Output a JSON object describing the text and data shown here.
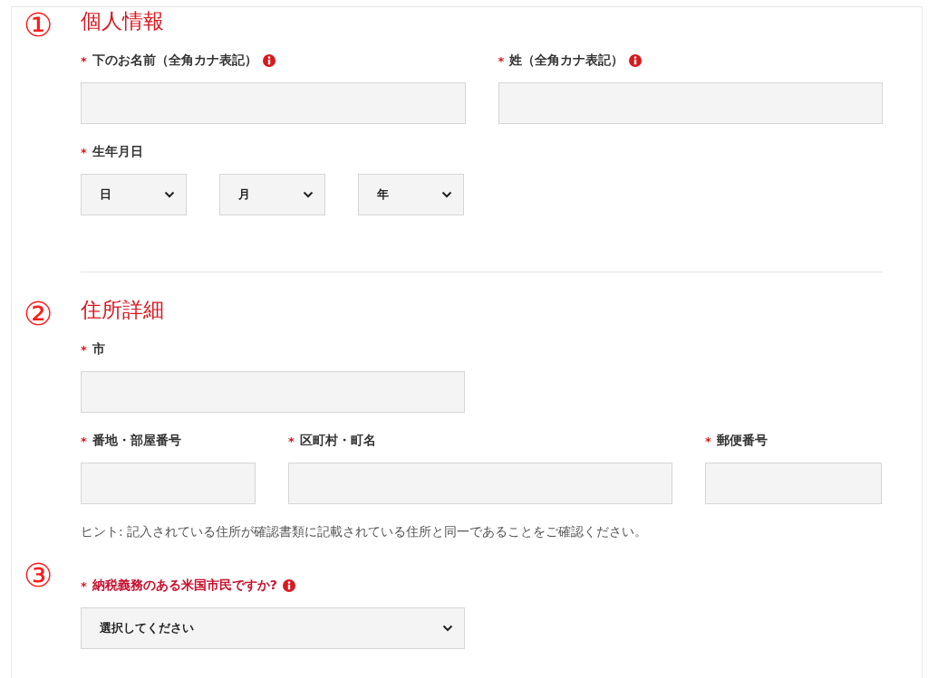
{
  "sections": [
    {
      "number": "①",
      "title": "個人情報",
      "divider": true,
      "rows": [
        [
          {
            "kind": "text",
            "mark": "*",
            "label": "下のお名前（全角カナ表記）",
            "info": true,
            "highlight": false
          },
          {
            "kind": "text",
            "mark": "*",
            "label": "姓（全角カナ表記）",
            "info": true,
            "highlight": false
          }
        ],
        [
          {
            "kind": "date",
            "mark": "*",
            "label": "生年月日",
            "info": false,
            "highlight": false,
            "values": [
              "日",
              "月",
              "年"
            ]
          }
        ]
      ]
    },
    {
      "number": "②",
      "title": "住所詳細",
      "divider": false,
      "hint": "ヒント: 記入されている住所が確認書類に記載されている住所と同一であることをご確認ください。",
      "rows": [
        [
          {
            "kind": "text",
            "mark": "*",
            "label": "市",
            "info": false,
            "highlight": false
          }
        ],
        [
          {
            "kind": "text",
            "mark": "*",
            "label": "番地・部屋番号",
            "info": false,
            "highlight": false
          },
          {
            "kind": "text",
            "mark": "*",
            "label": "区町村・町名",
            "info": false,
            "highlight": false
          },
          {
            "kind": "text",
            "mark": "*",
            "label": "郵便番号",
            "info": false,
            "highlight": false
          }
        ]
      ]
    },
    {
      "number": "③",
      "divider": false,
      "rows": [
        [
          {
            "kind": "select",
            "mark": "*",
            "label": "納税義務のある米国市民ですか?",
            "info": true,
            "highlight": true,
            "value": "選択してください"
          }
        ]
      ]
    }
  ]
}
